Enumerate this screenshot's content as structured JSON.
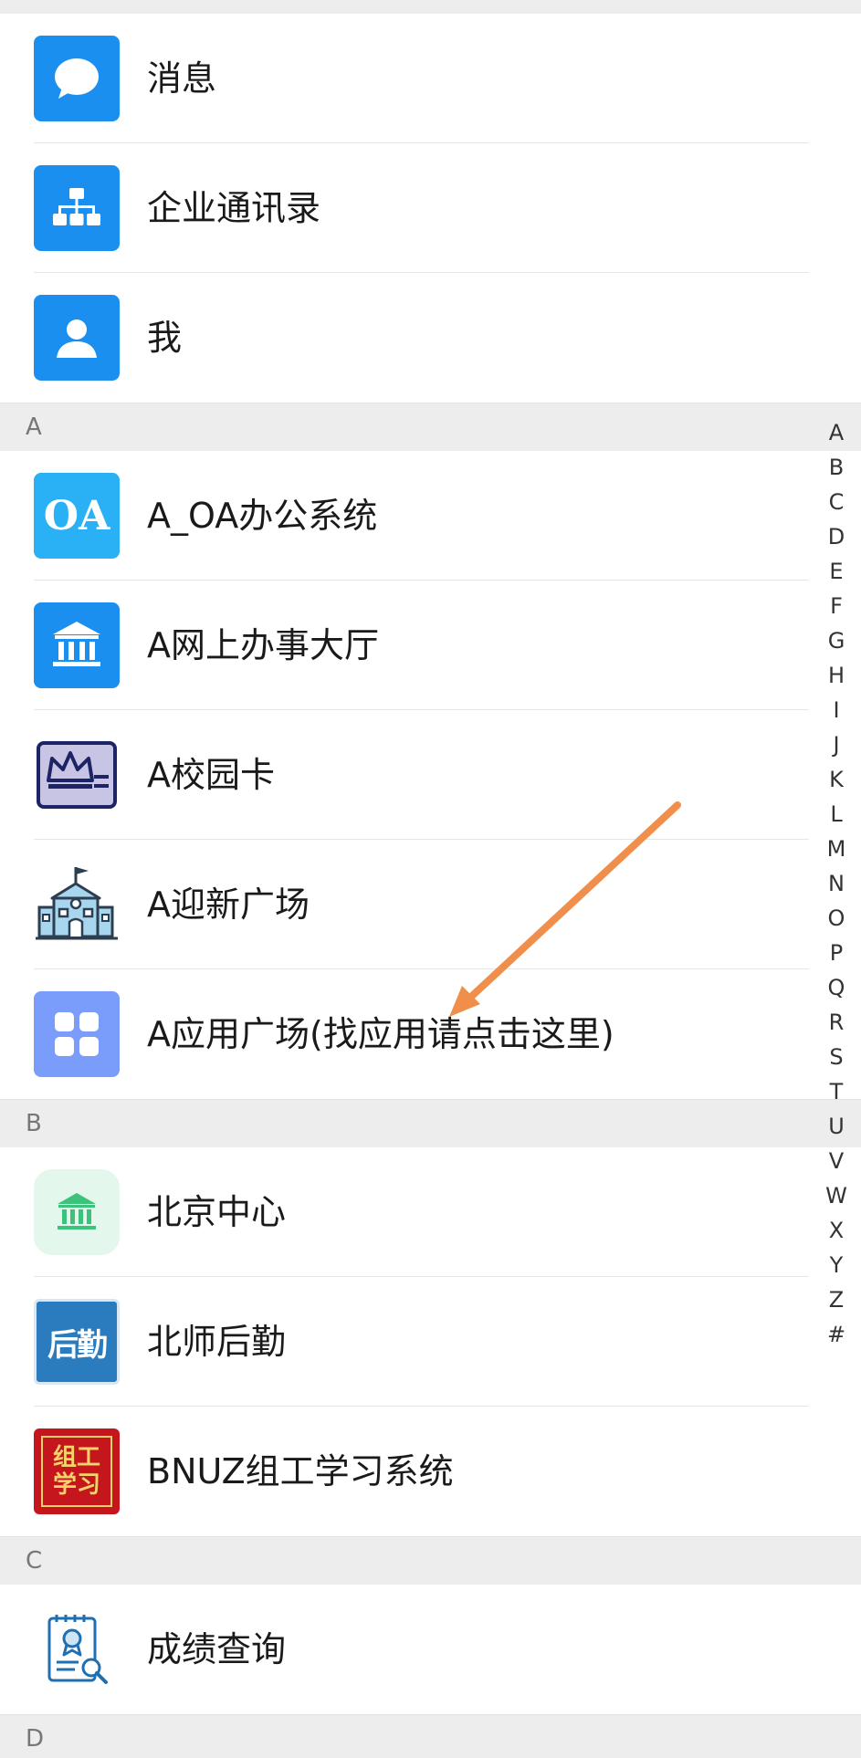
{
  "top_items": [
    {
      "label": "消息",
      "icon": "chat-bubble-icon"
    },
    {
      "label": "企业通讯录",
      "icon": "org-chart-icon"
    },
    {
      "label": "我",
      "icon": "person-icon"
    }
  ],
  "sections": [
    {
      "letter": "A",
      "items": [
        {
          "label": "A_OA办公系统",
          "icon": "oa-icon",
          "icon_text": "OA"
        },
        {
          "label": "A网上办事大厅",
          "icon": "government-building-icon"
        },
        {
          "label": "A校园卡",
          "icon": "campus-card-icon"
        },
        {
          "label": "A迎新广场",
          "icon": "school-building-icon"
        },
        {
          "label": "A应用广场(找应用请点击这里)",
          "icon": "app-grid-icon"
        }
      ]
    },
    {
      "letter": "B",
      "items": [
        {
          "label": "北京中心",
          "icon": "bank-icon"
        },
        {
          "label": "北师后勤",
          "icon": "logistics-logo-icon",
          "icon_text": "后勤"
        },
        {
          "label": "BNUZ组工学习系统",
          "icon": "study-system-logo-icon",
          "icon_text": "组工学习"
        }
      ]
    },
    {
      "letter": "C",
      "items": [
        {
          "label": "成绩查询",
          "icon": "certificate-search-icon"
        }
      ]
    },
    {
      "letter": "D",
      "items": []
    }
  ],
  "index_letters": [
    "A",
    "B",
    "C",
    "D",
    "E",
    "F",
    "G",
    "H",
    "I",
    "J",
    "K",
    "L",
    "M",
    "N",
    "O",
    "P",
    "Q",
    "R",
    "S",
    "T",
    "U",
    "V",
    "W",
    "X",
    "Y",
    "Z",
    "#"
  ],
  "colors": {
    "primary_blue": "#1a8ff0",
    "oa_blue": "#2ab0f5",
    "app_grid": "#7a9dfb",
    "arrow": "#ef8f4b",
    "section_bg": "#ededed"
  }
}
